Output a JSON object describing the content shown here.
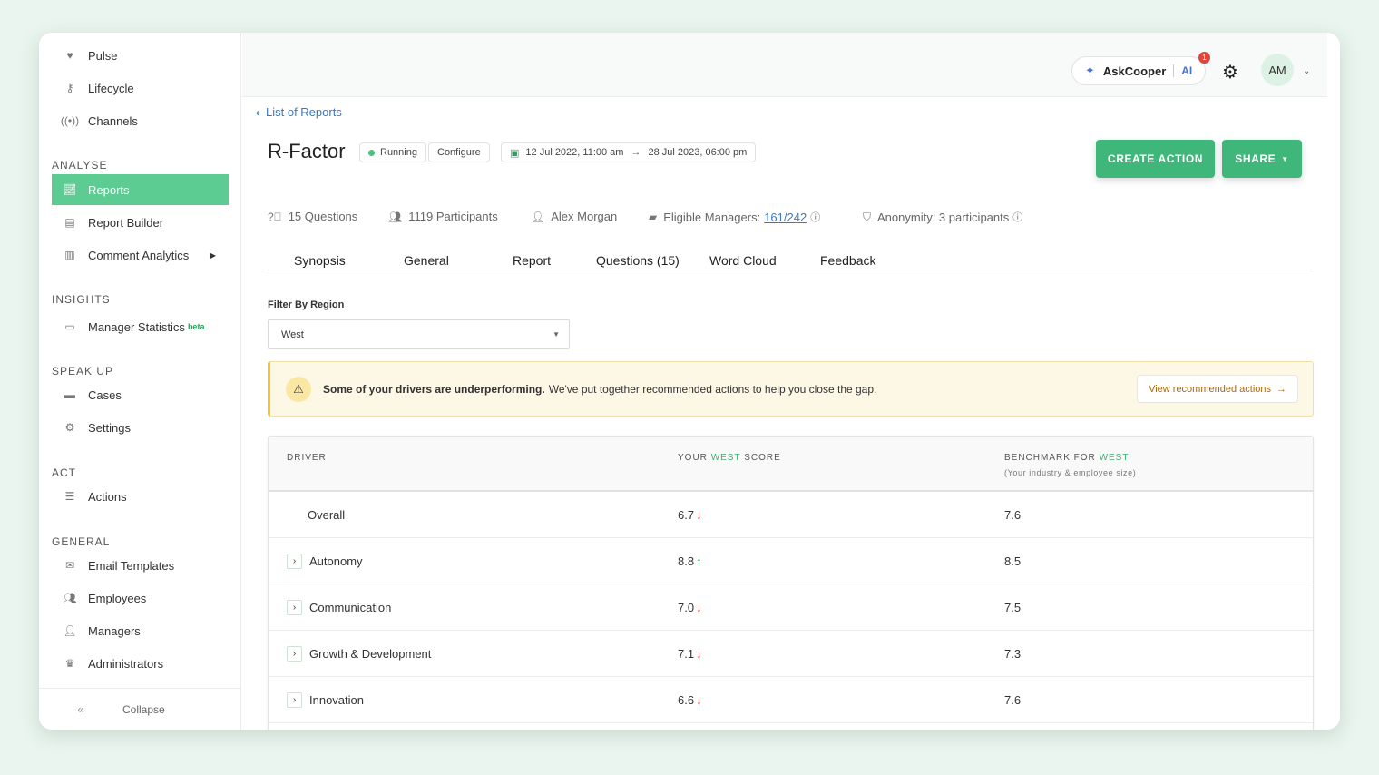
{
  "sidebar": {
    "top_items": [
      {
        "label": "Pulse",
        "icon": "heart-pulse-icon"
      },
      {
        "label": "Lifecycle",
        "icon": "key-icon"
      },
      {
        "label": "Channels",
        "icon": "broadcast-icon"
      }
    ],
    "sections": {
      "analyse": "ANALYSE",
      "insights": "INSIGHTS",
      "speak_up": "SPEAK UP",
      "act": "ACT",
      "general": "GENERAL"
    },
    "analyse_items": [
      {
        "label": "Reports",
        "icon": "chart-line-icon"
      },
      {
        "label": "Report Builder",
        "icon": "file-edit-icon"
      },
      {
        "label": "Comment Analytics",
        "icon": "bar-chart-icon"
      }
    ],
    "insights_items": [
      {
        "label": "Manager Statistics",
        "badge": "beta"
      }
    ],
    "speak_up_items": [
      {
        "label": "Cases"
      },
      {
        "label": "Settings"
      }
    ],
    "act_items": [
      {
        "label": "Actions"
      }
    ],
    "general_items": [
      {
        "label": "Email Templates"
      },
      {
        "label": "Employees"
      },
      {
        "label": "Managers"
      },
      {
        "label": "Administrators"
      }
    ],
    "collapse": "Collapse"
  },
  "topbar": {
    "askcooper": "AskCooper",
    "ai": "AI",
    "badge_count": "1",
    "avatar_initials": "AM"
  },
  "breadcrumb": "List of Reports",
  "report": {
    "title": "R-Factor",
    "status": "Running",
    "configure": "Configure",
    "date_start": "12 Jul 2022, 11:00 am",
    "date_end": "28 Jul 2023, 06:00 pm",
    "create_action": "CREATE ACTION",
    "share": "SHARE"
  },
  "meta": {
    "questions": "15 Questions",
    "participants": "1119 Participants",
    "owner": "Alex Morgan",
    "managers_label": "Eligible Managers:",
    "managers_value": "161/242",
    "anonymity": "Anonymity: 3 participants"
  },
  "tabs": [
    "Synopsis",
    "General",
    "Report",
    "Questions (15)",
    "Word Cloud",
    "Feedback"
  ],
  "filter": {
    "label": "Filter By Region",
    "value": "West"
  },
  "alert": {
    "bold": "Some of your drivers are underperforming.",
    "text": "We've put together recommended actions to help you close the gap.",
    "button": "View recommended actions"
  },
  "table": {
    "col_driver": "DRIVER",
    "col_score_pre": "YOUR",
    "col_score_hl": "WEST",
    "col_score_post": "SCORE",
    "col_bench_pre": "BENCHMARK FOR",
    "col_bench_hl": "WEST",
    "col_bench_sub": "(Your industry & employee size)",
    "rows": [
      {
        "driver": "Overall",
        "score": "6.7",
        "trend": "down",
        "benchmark": "7.6"
      },
      {
        "driver": "Autonomy",
        "score": "8.8",
        "trend": "up",
        "benchmark": "8.5"
      },
      {
        "driver": "Communication",
        "score": "7.0",
        "trend": "down",
        "benchmark": "7.5"
      },
      {
        "driver": "Growth & Development",
        "score": "7.1",
        "trend": "down",
        "benchmark": "7.3"
      },
      {
        "driver": "Innovation",
        "score": "6.6",
        "trend": "down",
        "benchmark": "7.6"
      }
    ]
  },
  "colors": {
    "accent": "#5dcc93",
    "primary_button": "#40b77a",
    "link": "#3a78c2",
    "down": "#d13b3b",
    "up": "#2e9d5e"
  }
}
